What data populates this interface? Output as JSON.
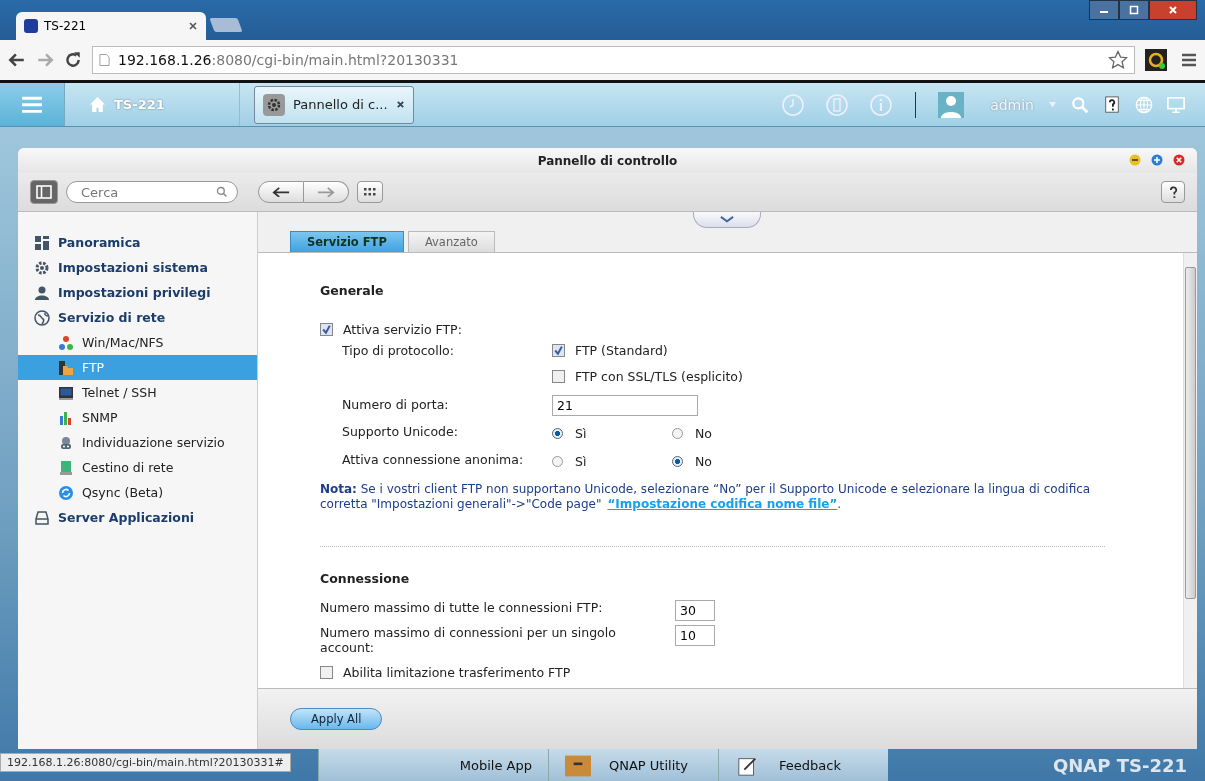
{
  "browser": {
    "tab_title": "TS-221",
    "url_host": "192.168.1.26",
    "url_path": ":8080/cgi-bin/main.html?20130331",
    "status_url": "192.168.1.26:8080/cgi-bin/main.html?20130331#"
  },
  "topbar": {
    "home_label": "TS-221",
    "open_app": "Pannello di c...",
    "user": "admin"
  },
  "window": {
    "title": "Pannello di controllo",
    "search_placeholder": "Cerca"
  },
  "sidebar": {
    "items": [
      {
        "label": "Panoramica",
        "selected": false
      },
      {
        "label": "Impostazioni sistema",
        "selected": false
      },
      {
        "label": "Impostazioni privilegi",
        "selected": false
      },
      {
        "label": "Servizio di rete",
        "selected": false,
        "children": [
          {
            "label": "Win/Mac/NFS",
            "selected": false
          },
          {
            "label": "FTP",
            "selected": true
          },
          {
            "label": "Telnet / SSH",
            "selected": false
          },
          {
            "label": "SNMP",
            "selected": false
          },
          {
            "label": "Individuazione servizio",
            "selected": false
          },
          {
            "label": "Cestino di rete",
            "selected": false
          },
          {
            "label": "Qsync (Beta)",
            "selected": false
          }
        ]
      },
      {
        "label": "Server Applicazioni",
        "selected": false
      }
    ]
  },
  "tabs": [
    {
      "label": "Servizio FTP",
      "selected": true
    },
    {
      "label": "Avanzato",
      "selected": false
    }
  ],
  "general": {
    "title": "Generale",
    "enable": {
      "label": "Attiva servizio FTP:",
      "checked": true
    },
    "protocol": {
      "label": "Tipo di protocollo:",
      "options": [
        {
          "label": "FTP (Standard)",
          "checked": true
        },
        {
          "label": "FTP con SSL/TLS (esplicito)",
          "checked": false
        }
      ]
    },
    "port": {
      "label": "Numero di porta:",
      "value": "21"
    },
    "radios": [
      {
        "label": "Supporto Unicode:",
        "options": [
          {
            "label": "Sì",
            "selected": true
          },
          {
            "label": "No",
            "selected": false
          }
        ]
      },
      {
        "label": "Attiva connessione anonima:",
        "options": [
          {
            "label": "Sì",
            "selected": false
          },
          {
            "label": "No",
            "selected": true
          }
        ]
      }
    ],
    "note": {
      "text": "**Nota:** Se i vostri client FTP non supportano Unicode, selezionare  “No”  per il Supporto Unicode e selezionare la lingua di codifica corretta \"Impostazioni generali\"->\"Code page\"",
      "link": "“Impostazione codifica nome file”",
      "end": "."
    }
  },
  "connection": {
    "title": "Connessione",
    "fields": [
      {
        "label": "Numero massimo di tutte le connessioni FTP:",
        "value": "30"
      },
      {
        "label": "Numero massimo di connessioni per un singolo account:",
        "value": "10"
      }
    ],
    "limit": {
      "label": "Abilita limitazione trasferimento FTP",
      "checked": false
    }
  },
  "footer": {
    "apply": "Apply All"
  },
  "taskbar": {
    "items": [
      "Mobile App",
      "QNAP Utility",
      "Feedback"
    ],
    "logo": "QNAP TS-221"
  }
}
